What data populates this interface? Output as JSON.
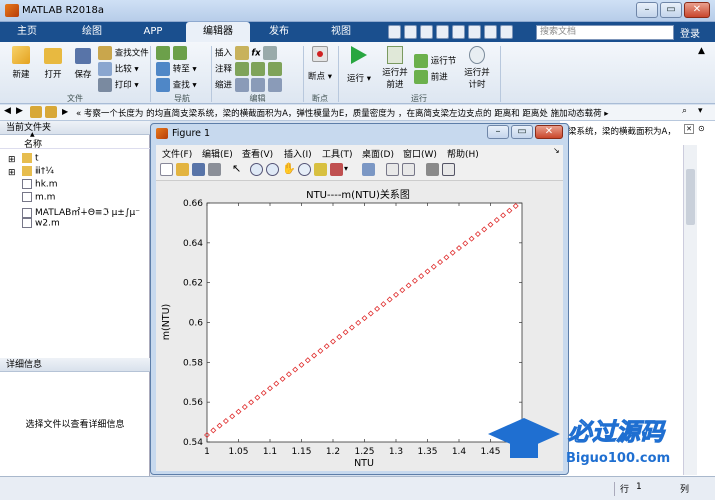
{
  "window": {
    "title": "MATLAB R2018a"
  },
  "tabs": [
    "主页",
    "绘图",
    "APP",
    "编辑器",
    "发布",
    "视图"
  ],
  "search": {
    "placeholder": "搜索文档"
  },
  "login": "登录",
  "ribbon": {
    "file": {
      "new": "新建",
      "open": "打开",
      "save": "保存",
      "find_files": "查找文件",
      "compare": "比较",
      "print": "打印",
      "group": "文件"
    },
    "nav": {
      "goto": "转至",
      "find": "查找",
      "group": "导航"
    },
    "edit": {
      "insert": "插入",
      "comment": "注释",
      "indent": "缩进",
      "group": "编辑"
    },
    "breakpoints": {
      "label": "断点",
      "group": "断点"
    },
    "run": {
      "run": "运行",
      "run_advance_1": "运行并",
      "run_advance_2": "前进",
      "run_section": "运行节",
      "advance": "前进",
      "run_time_1": "运行并",
      "run_time_2": "计时",
      "group": "运行"
    }
  },
  "address": {
    "text": "«  考察一个长度为  的均直简支梁系统，梁的横截面积为A，弹性模量为E，质量密度为  ，在离简支梁左边支点的  距离和  距离处  施加动态载荷  ▸",
    "right_text": "梁系统，梁的横截面积为A，"
  },
  "current_folder": {
    "title": "当前文件夹",
    "col_name": "名称",
    "col_sort": "▲",
    "items": [
      {
        "name": "t",
        "type": "folder"
      },
      {
        "name": "ⅲ†¼",
        "type": "folder"
      },
      {
        "name": "hk.m",
        "type": "file"
      },
      {
        "name": "m.m",
        "type": "file"
      },
      {
        "name": "MATLAB㎡∔Θ≡ℑ µ±∫µ⁻",
        "type": "mfile"
      },
      {
        "name": "w2.m",
        "type": "file"
      }
    ]
  },
  "details": {
    "title": "详细信息",
    "empty": "选择文件以查看详细信息"
  },
  "status": {
    "row_label": "行",
    "row_value": "1",
    "col_label": "列"
  },
  "figure": {
    "title": "Figure 1",
    "menu": [
      "文件(F)",
      "编辑(E)",
      "查看(V)",
      "插入(I)",
      "工具(T)",
      "桌面(D)",
      "窗口(W)",
      "帮助(H)"
    ]
  },
  "chart_data": {
    "type": "scatter",
    "title": "NTU----m(NTU)关系图",
    "xlabel": "NTU",
    "ylabel": "m(NTU)",
    "xlim": [
      1,
      1.5
    ],
    "ylim": [
      0.54,
      0.66
    ],
    "xticks": [
      1,
      1.05,
      1.1,
      1.15,
      1.2,
      1.25,
      1.3,
      1.35,
      1.4,
      1.45
    ],
    "xtick_labels": [
      "1",
      "1.05",
      "1.1",
      "1.15",
      "1.2",
      "1.25",
      "1.3",
      "1.35",
      "1.4",
      "1.45"
    ],
    "yticks": [
      0.54,
      0.56,
      0.58,
      0.6,
      0.62,
      0.64,
      0.66
    ],
    "ytick_labels": [
      "0.54",
      "0.56",
      "0.58",
      "0.6",
      "0.62",
      "0.64",
      "0.66"
    ],
    "marker": "diamond",
    "color": "#e03030",
    "series": [
      {
        "x_start": 1.0,
        "x_end": 1.49,
        "x_step": 0.01,
        "y_start": 0.5435,
        "y_end": 0.6585
      }
    ]
  },
  "watermark": {
    "text": "必过源码",
    "url": "Biguo100.com"
  },
  "colors": {
    "ribbon_tab": "#1a4f8e",
    "accent": "#1f6fd1",
    "plot_marker": "#e03030"
  }
}
